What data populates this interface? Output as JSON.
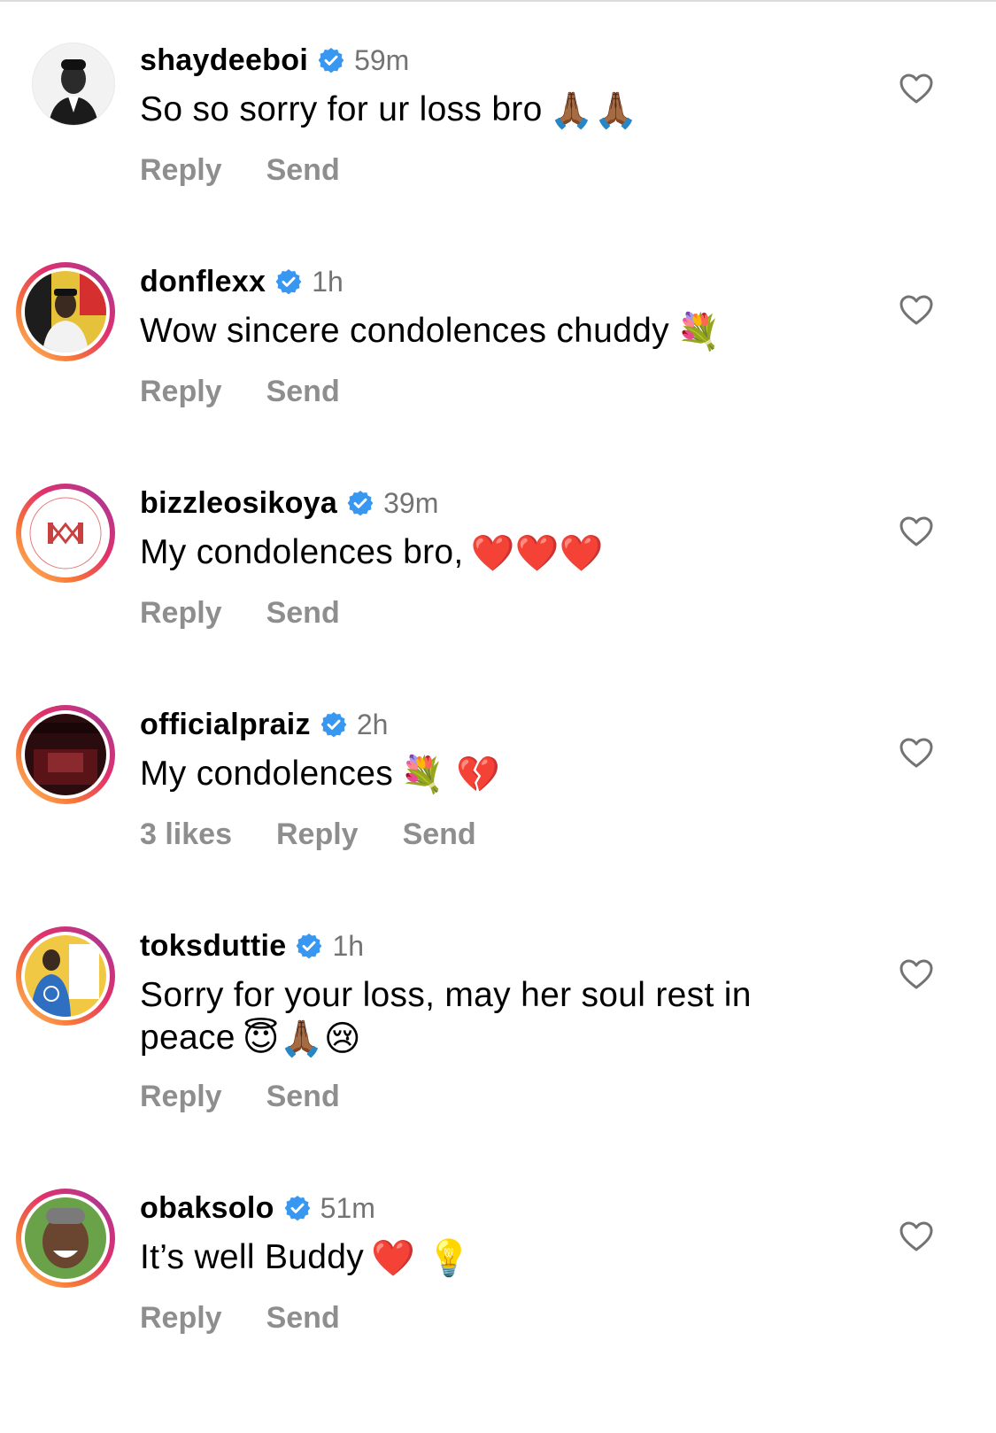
{
  "comments": [
    {
      "username": "shaydeeboi",
      "time": "59m",
      "text": "So so sorry for ur loss bro",
      "emojis": "🙏🏾🙏🏾",
      "text_line2": "",
      "emojis_line2": "",
      "likes": "",
      "reply_label": "Reply",
      "send_label": "Send"
    },
    {
      "username": "donflexx",
      "time": "1h",
      "text": "Wow sincere condolences chuddy",
      "emojis": "💐",
      "text_line2": "",
      "emojis_line2": "",
      "likes": "",
      "reply_label": "Reply",
      "send_label": "Send"
    },
    {
      "username": "bizzleosikoya",
      "time": "39m",
      "text": "My condolences bro,",
      "emojis": "❤️❤️❤️",
      "text_line2": "",
      "emojis_line2": "",
      "likes": "",
      "reply_label": "Reply",
      "send_label": "Send"
    },
    {
      "username": "officialpraiz",
      "time": "2h",
      "text": "My condolences",
      "emojis": "💐 💔",
      "text_line2": "",
      "emojis_line2": "",
      "likes": "3 likes",
      "reply_label": "Reply",
      "send_label": "Send"
    },
    {
      "username": "toksduttie",
      "time": "1h",
      "text": "Sorry for your loss, may her soul rest in",
      "emojis": "",
      "text_line2": "peace",
      "emojis_line2": "😇🙏🏾😢",
      "likes": "",
      "reply_label": "Reply",
      "send_label": "Send"
    },
    {
      "username": "obaksolo",
      "time": "51m",
      "text": "It’s well Buddy",
      "emojis": "❤️ 💡",
      "text_line2": "",
      "emojis_line2": "",
      "likes": "",
      "reply_label": "Reply",
      "send_label": "Send"
    }
  ],
  "icons": {
    "verified": "verified-badge-icon",
    "like": "heart-outline-icon"
  },
  "colors": {
    "verified_blue": "#3897f0",
    "secondary_text": "#8e8e8e",
    "time_text": "#737373",
    "story_ring_start": "#fdc468",
    "story_ring_end": "#833ab4"
  }
}
